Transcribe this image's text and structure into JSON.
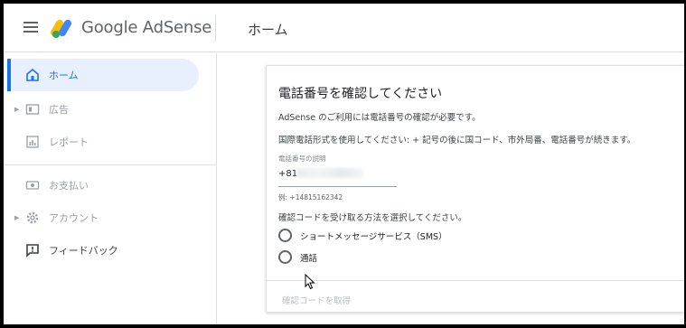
{
  "header": {
    "logo_text": "Google AdSense",
    "page_title": "ホーム"
  },
  "sidebar": {
    "items": [
      {
        "label": "ホーム",
        "icon": "home-icon",
        "active": true
      },
      {
        "label": "広告",
        "icon": "ads-icon"
      },
      {
        "label": "レポート",
        "icon": "report-icon"
      },
      {
        "label": "お支払い",
        "icon": "payments-icon"
      },
      {
        "label": "アカウント",
        "icon": "gear-icon"
      },
      {
        "label": "フィードバック",
        "icon": "feedback-icon"
      }
    ]
  },
  "card": {
    "title": "電話番号を確認してください",
    "line1": "AdSense のご利用には電話番号の確認が必要です。",
    "line2": "国際電話形式を使用してください: + 記号の後に国コード、市外局番、電話番号が続きます。",
    "field_label": "電話番号の説明",
    "field_prefix": "+81",
    "field_hint": "例: +14815162342",
    "method_prompt": "確認コードを受け取る方法を選択してください。",
    "options": [
      "ショートメッセージサービス（SMS）",
      "通話"
    ],
    "get_code": "確認コードを取得"
  },
  "colors": {
    "accent": "#1a73e8",
    "active_bg": "#e8f0fe"
  }
}
